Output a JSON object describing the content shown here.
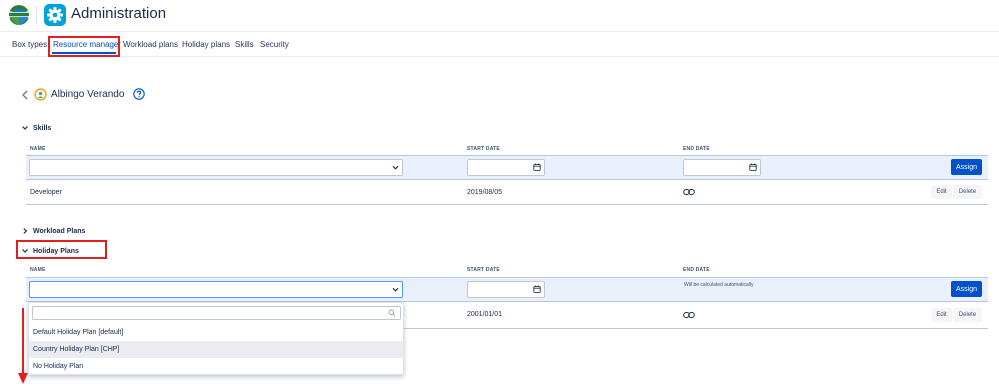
{
  "header": {
    "title": "Administration"
  },
  "tabs": [
    {
      "label": "Box types"
    },
    {
      "label": "Resource manager"
    },
    {
      "label": "Workload plans"
    },
    {
      "label": "Holiday plans"
    },
    {
      "label": "Skills"
    },
    {
      "label": "Security"
    }
  ],
  "active_tab": "Resource manager",
  "person": {
    "name": "Albingo Verando"
  },
  "columns": {
    "name": "NAME",
    "start_date": "START DATE",
    "end_date": "END DATE"
  },
  "skills": {
    "title": "Skills",
    "assign_label": "Assign",
    "rows": [
      {
        "name": "Developer",
        "start": "2019/08/05",
        "edit": "Edit",
        "delete": "Delete"
      }
    ]
  },
  "workload": {
    "title": "Workload Plans"
  },
  "holiday": {
    "title": "Holiday Plans",
    "end_note": "Will be calculated automatically",
    "assign_label": "Assign",
    "rows": [
      {
        "start": "2001/01/01",
        "edit": "Edit",
        "delete": "Delete"
      }
    ]
  },
  "dropdown": {
    "search_placeholder": "",
    "options": [
      {
        "label": "Default Holiday Plan [default]"
      },
      {
        "label": "Country Holiday Plan [CHP]"
      },
      {
        "label": "No Holiday Plan"
      }
    ],
    "highlighted": "Country Holiday Plan [CHP]"
  },
  "colors": {
    "accent": "#0052cc",
    "annotation": "#e02020",
    "band": "#e9f0fb"
  }
}
